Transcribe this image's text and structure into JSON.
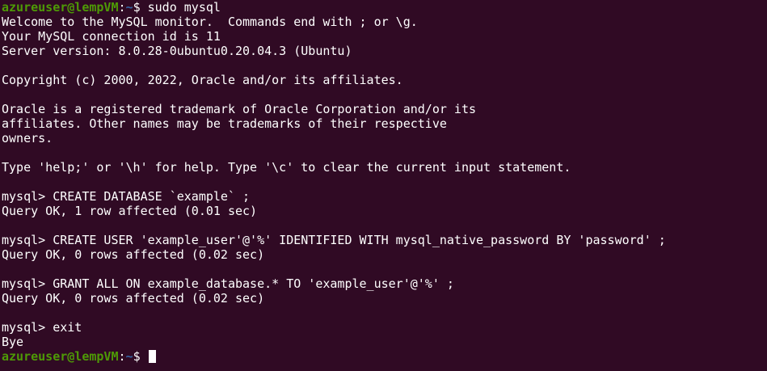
{
  "terminal": {
    "prompt": {
      "user_host": "azureuser@lempVM",
      "sep": ":",
      "path": "~",
      "symbol": "$"
    },
    "command_first": "sudo mysql",
    "output": {
      "welcome": "Welcome to the MySQL monitor.  Commands end with ; or \\g.",
      "connection": "Your MySQL connection id is 11",
      "server_version": "Server version: 8.0.28-0ubuntu0.20.04.3 (Ubuntu)",
      "copyright": "Copyright (c) 2000, 2022, Oracle and/or its affiliates.",
      "trademark_1": "Oracle is a registered trademark of Oracle Corporation and/or its",
      "trademark_2": "affiliates. Other names may be trademarks of their respective",
      "trademark_3": "owners.",
      "help_hint": "Type 'help;' or '\\h' for help. Type '\\c' to clear the current input statement."
    },
    "mysql_session": [
      {
        "cmd": "mysql> CREATE DATABASE `example` ;",
        "result": "Query OK, 1 row affected (0.01 sec)"
      },
      {
        "cmd": "mysql> CREATE USER 'example_user'@'%' IDENTIFIED WITH mysql_native_password BY 'password' ;",
        "result": "Query OK, 0 rows affected (0.02 sec)"
      },
      {
        "cmd": "mysql> GRANT ALL ON example_database.* TO 'example_user'@'%' ;",
        "result": "Query OK, 0 rows affected (0.02 sec)"
      }
    ],
    "exit_cmd": "mysql> exit",
    "bye": "Bye",
    "colors": {
      "background": "#300a24",
      "text": "#ffffff",
      "user_host": "#4e9a06",
      "path": "#3465a4"
    }
  }
}
